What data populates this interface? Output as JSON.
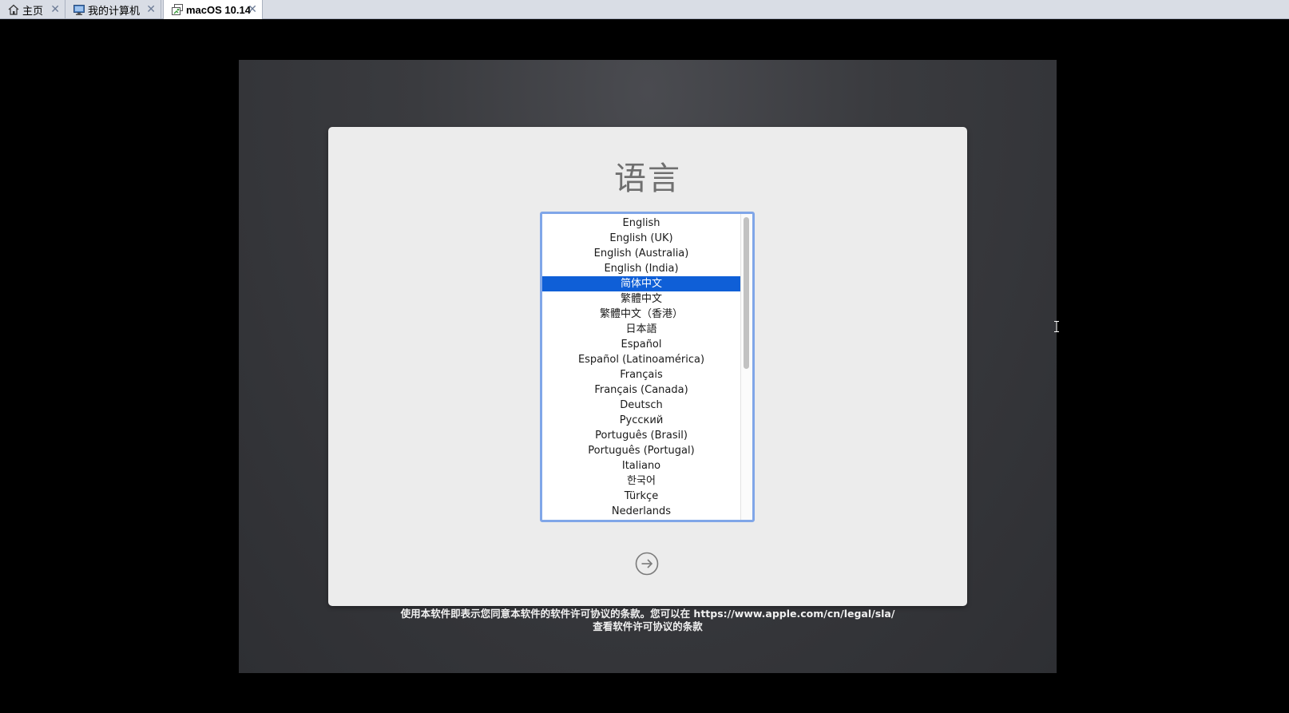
{
  "tabs": [
    {
      "label": "主页",
      "icon": "home-icon",
      "active": false
    },
    {
      "label": "我的计算机",
      "icon": "computer-icon",
      "active": false
    },
    {
      "label": "macOS 10.14",
      "icon": "virtual-machine-icon",
      "active": true
    }
  ],
  "close_glyph": "✕",
  "dialog": {
    "title": "语言",
    "languages": [
      "English",
      "English (UK)",
      "English (Australia)",
      "English (India)",
      "简体中文",
      "繁體中文",
      "繁體中文（香港）",
      "日本語",
      "Español",
      "Español (Latinoamérica)",
      "Français",
      "Français (Canada)",
      "Deutsch",
      "Русский",
      "Português (Brasil)",
      "Português (Portugal)",
      "Italiano",
      "한국어",
      "Türkçe",
      "Nederlands"
    ],
    "selected_language": "简体中文",
    "next_button_icon": "arrow-right-circle-icon"
  },
  "legal": {
    "line1": "使用本软件即表示您同意本软件的软件许可协议的条款。您可以在 https://www.apple.com/cn/legal/sla/",
    "line2": "查看软件许可协议的条款"
  },
  "colors": {
    "selection": "#0f5fd7",
    "list_focus_border": "#80a6e8",
    "dialog_bg": "#ececec"
  }
}
